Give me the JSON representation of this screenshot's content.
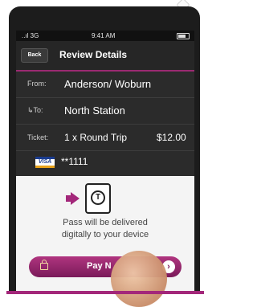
{
  "status_bar": {
    "carrier": "..ıl 3G",
    "time": "9:41 AM"
  },
  "nav": {
    "back_label": "Back",
    "title": "Review Details"
  },
  "details": {
    "from_label": "From:",
    "from_value": "Anderson/ Woburn",
    "to_label": "To:",
    "to_value": "North Station",
    "ticket_label": "Ticket:",
    "ticket_value": "1 x Round Trip",
    "price": "$12.00",
    "card_brand": "VISA",
    "card_number": "**1111"
  },
  "delivery": {
    "line1": "Pass will be delivered",
    "line2": "digitally to your device",
    "device_glyph": "T"
  },
  "pay_button": {
    "label": "Pay N",
    "chevron": "›"
  },
  "colors": {
    "accent": "#a3277a",
    "background": "#2b2b2b",
    "panel": "#f4f4f4"
  },
  "icons": [
    "battery-icon",
    "arrow-icon",
    "device-icon",
    "lock-icon",
    "chevron-right-icon"
  ]
}
